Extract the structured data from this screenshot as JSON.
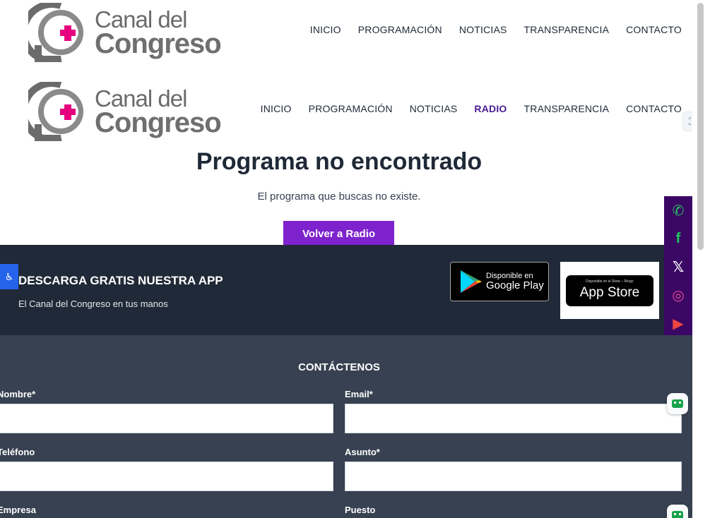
{
  "logo": {
    "line1": "Canal del",
    "line2": "Congreso",
    "colors": {
      "gray": "#6b6b6b",
      "magenta": "#e6007e"
    }
  },
  "header1": {
    "nav": [
      "INICIO",
      "PROGRAMACIÓN",
      "NOTICIAS",
      "TRANSPARENCIA",
      "CONTACTO"
    ]
  },
  "header2": {
    "nav": [
      "INICIO",
      "PROGRAMACIÓN",
      "NOTICIAS",
      "RADIO",
      "TRANSPARENCIA",
      "CONTACTO"
    ],
    "active": "RADIO"
  },
  "notfound": {
    "title": "Programa no encontrado",
    "message": "El programa que buscas no existe.",
    "button": "Volver a Radio"
  },
  "app": {
    "title": "DESCARGA GRATIS NUESTRA APP",
    "subtitle": "El Canal del Congreso en tus manos",
    "google_play": {
      "small": "Disponible en",
      "big": "Google Play"
    },
    "app_store": {
      "small": "Disponible en el Store – Ringo",
      "big": "App Store"
    }
  },
  "social": {
    "icons": [
      "whatsapp-icon",
      "facebook-icon",
      "x-icon",
      "instagram-icon",
      "youtube-icon",
      "tiktok-icon"
    ],
    "color": "#22c55e"
  },
  "contact": {
    "title": "CONTÁCTENOS",
    "fields": {
      "nombre": "Nombre*",
      "email": "Email*",
      "telefono": "Teléfono",
      "asunto": "Asunto*",
      "empresa": "Empresa",
      "puesto": "Puesto"
    }
  },
  "colors": {
    "purple_button": "#7e22ce",
    "active_nav": "#4c1d95",
    "app_band": "#1f2937",
    "contact_band": "#374151",
    "social_bar": "#3b0764"
  }
}
